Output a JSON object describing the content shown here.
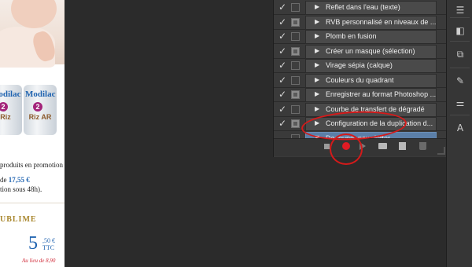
{
  "webpage": {
    "promo_line1": "produits en promotion",
    "promo_line2_prefix": "de ",
    "promo_line2_price": "17,55 €",
    "promo_line3": "tion sous 48h).",
    "section_title": "UBLIME",
    "can_brand": "Modilac",
    "can_badge": "2",
    "can1_text": "Riz",
    "can2_text": "Riz AR",
    "price_main": "5",
    "price_cents": ",50 €",
    "price_ttc": "TTC",
    "price_old": "Au lieu de 8,90"
  },
  "actions_panel": {
    "items": [
      {
        "label": "Reflet dans l'eau (texte)",
        "checked": true,
        "dialog": false,
        "expanded": false,
        "selected": false
      },
      {
        "label": "RVB personnalisé en niveaux de ...",
        "checked": true,
        "dialog": true,
        "expanded": false,
        "selected": false
      },
      {
        "label": "Plomb en fusion",
        "checked": true,
        "dialog": false,
        "expanded": false,
        "selected": false
      },
      {
        "label": "Créer un masque (sélection)",
        "checked": true,
        "dialog": true,
        "expanded": false,
        "selected": false
      },
      {
        "label": "Virage sépia (calque)",
        "checked": true,
        "dialog": false,
        "expanded": false,
        "selected": false
      },
      {
        "label": "Couleurs du quadrant",
        "checked": true,
        "dialog": false,
        "expanded": false,
        "selected": false
      },
      {
        "label": "Enregistrer au format Photoshop ...",
        "checked": true,
        "dialog": true,
        "expanded": false,
        "selected": false
      },
      {
        "label": "Courbe de transfert de dégradé",
        "checked": true,
        "dialog": false,
        "expanded": false,
        "selected": false
      },
      {
        "label": "Configuration de la duplication d...",
        "checked": true,
        "dialog": true,
        "expanded": false,
        "selected": false
      },
      {
        "label": "Decoupe_newsletter",
        "checked": false,
        "dialog": false,
        "expanded": true,
        "selected": true
      }
    ],
    "check_glyph": "✓",
    "collapsed_glyph": "▶",
    "expanded_glyph": "▼"
  },
  "dock": {
    "icons": [
      "layers-icon",
      "3d-icon",
      "clone-source-icon",
      "brush-presets-icon",
      "adjustments-icon",
      "character-icon"
    ],
    "glyphs": [
      "☰",
      "◧",
      "⧉",
      "✎",
      "⚌",
      "A"
    ]
  },
  "colors": {
    "record": "#e01b24",
    "annotation": "#d41a1a",
    "selected_row": "#5b7fa8"
  }
}
